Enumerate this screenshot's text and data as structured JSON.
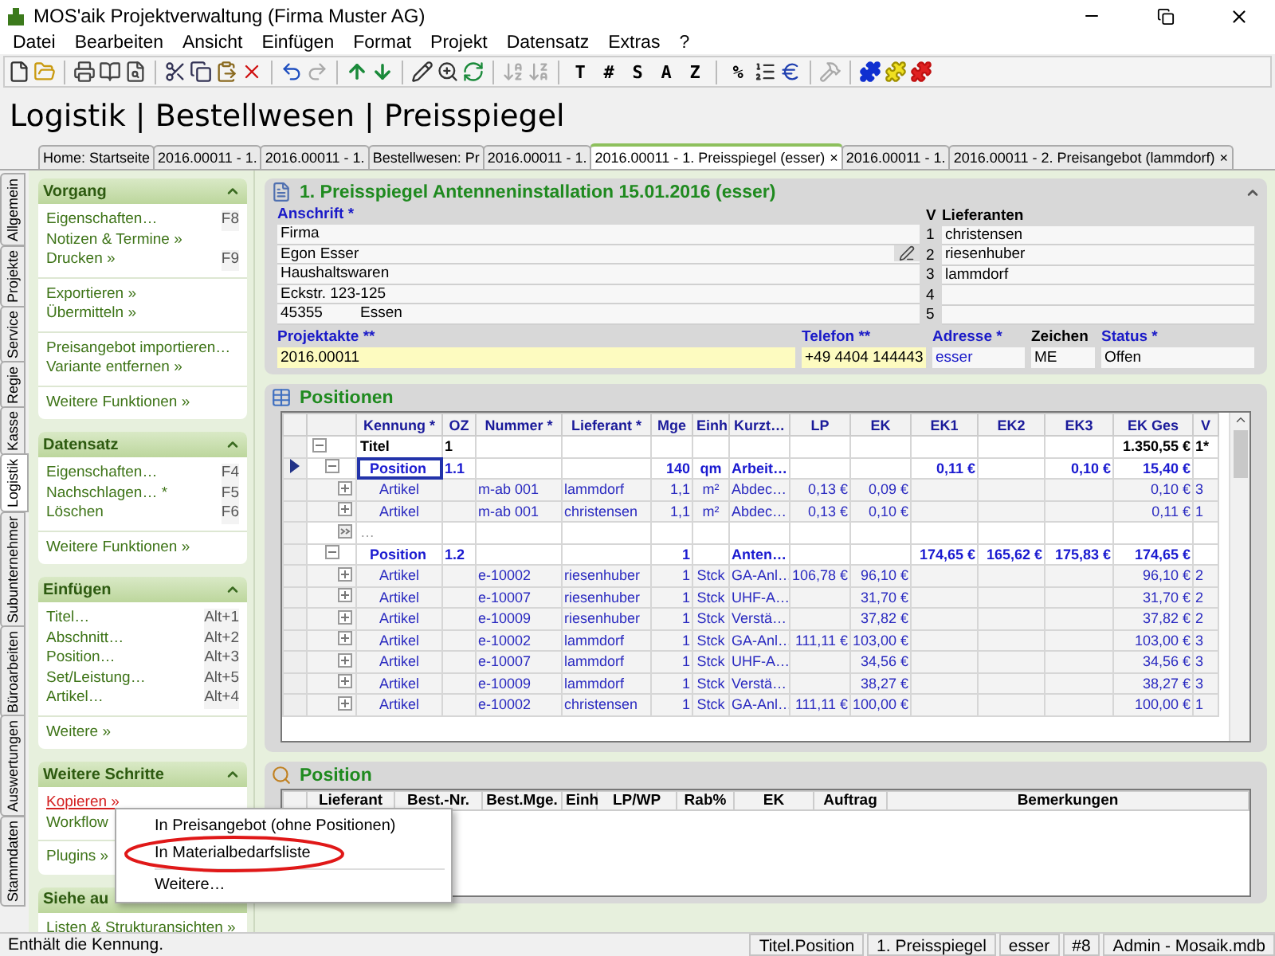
{
  "window": {
    "title": "MOS'aik Projektverwaltung (Firma Muster AG)"
  },
  "menu": [
    "Datei",
    "Bearbeiten",
    "Ansicht",
    "Einfügen",
    "Format",
    "Projekt",
    "Datensatz",
    "Extras",
    "?"
  ],
  "toolbar": {
    "text_buttons": [
      [
        "T",
        "#",
        "S",
        "A",
        "Z"
      ],
      [
        "%"
      ]
    ]
  },
  "heading": "Logistik | Bestellwesen | Preisspiegel",
  "doc_tabs": [
    {
      "label": "Home: Startseite",
      "selected": false
    },
    {
      "label": "2016.00011 - 1.",
      "selected": false
    },
    {
      "label": "2016.00011 - 1.",
      "selected": false
    },
    {
      "label": "Bestellwesen: Pr",
      "selected": false
    },
    {
      "label": "2016.00011 - 1.",
      "selected": false
    },
    {
      "label": "2016.00011 - 1. Preisspiegel (esser)",
      "close": "×",
      "selected": true
    },
    {
      "label": "2016.00011 - 1.",
      "selected": false
    },
    {
      "label": "2016.00011 - 2. Preisangebot (lammdorf)",
      "close": "×",
      "selected": false
    }
  ],
  "side_tabs": [
    {
      "label": "Allgemein",
      "selected": false
    },
    {
      "label": "Projekte",
      "selected": false
    },
    {
      "label": "Service",
      "selected": false
    },
    {
      "label": "Regie",
      "selected": false
    },
    {
      "label": "Kasse",
      "selected": false
    },
    {
      "label": "Logistik",
      "selected": true
    },
    {
      "label": "Subunternehmer",
      "selected": false
    },
    {
      "label": "Büroarbeiten",
      "selected": false
    },
    {
      "label": "Auswertungen",
      "selected": false
    },
    {
      "label": "Stammdaten",
      "selected": false
    }
  ],
  "sidebar": [
    {
      "title": "Vorgang",
      "expanded": true,
      "groups": [
        [
          {
            "label": "Eigenschaften…",
            "shortcut": "F8",
            "hovered": false
          },
          {
            "label": "Notizen & Termine »",
            "hovered": false
          },
          {
            "label": "Drucken »",
            "shortcut": "F9",
            "hovered": false
          }
        ],
        [
          {
            "label": "Exportieren »",
            "hovered": false
          },
          {
            "label": "Übermitteln »",
            "hovered": false
          }
        ],
        [
          {
            "label": "Preisangebot importieren…",
            "hovered": false
          },
          {
            "label": "Variante entfernen »",
            "hovered": false
          }
        ],
        [
          {
            "label": "Weitere Funktionen »",
            "hovered": false
          }
        ]
      ]
    },
    {
      "title": "Datensatz",
      "expanded": true,
      "groups": [
        [
          {
            "label": "Eigenschaften…",
            "shortcut": "F4",
            "hovered": false
          },
          {
            "label": "Nachschlagen… *",
            "shortcut": "F5",
            "hovered": false
          },
          {
            "label": "Löschen",
            "shortcut": "F6",
            "hovered": false
          }
        ],
        [
          {
            "label": "Weitere Funktionen »",
            "hovered": false
          }
        ]
      ]
    },
    {
      "title": "Einfügen",
      "expanded": true,
      "groups": [
        [
          {
            "label": "Titel…",
            "shortcut": "Alt+1",
            "hovered": false
          },
          {
            "label": "Abschnitt…",
            "shortcut": "Alt+2",
            "hovered": false
          },
          {
            "label": "Position…",
            "shortcut": "Alt+3",
            "hovered": false
          },
          {
            "label": "Set/Leistung…",
            "shortcut": "Alt+5",
            "hovered": false
          },
          {
            "label": "Artikel…",
            "shortcut": "Alt+4",
            "hovered": false
          }
        ],
        [
          {
            "label": "Weitere »",
            "hovered": false
          }
        ]
      ]
    },
    {
      "title": "Weitere Schritte",
      "expanded": true,
      "groups": [
        [
          {
            "label": "Kopieren »",
            "hovered": true
          },
          {
            "label": "Workflow",
            "hovered": false
          }
        ],
        [
          {
            "label": "Plugins »",
            "hovered": false
          }
        ]
      ]
    },
    {
      "title": "Siehe au",
      "groups": [
        [
          {
            "label": "Listen & Strukturansichten »",
            "hovered": false
          }
        ]
      ]
    }
  ],
  "popup": {
    "items": [
      {
        "label": "In Preisangebot (ohne Positionen)",
        "highlighted": false,
        "separator_before": false
      },
      {
        "label": "In Materialbedarfsliste",
        "highlighted": true,
        "separator_before": false
      },
      {
        "label": "Weitere…",
        "highlighted": false,
        "separator_before": true
      }
    ]
  },
  "document": {
    "title": "1. Preisspiegel Antenneninstallation 15.01.2016 (esser)",
    "address": {
      "label": "Anschrift *",
      "lines": [
        {
          "text": "Firma",
          "has_button": false
        },
        {
          "text": "Egon Esser",
          "has_button": true
        },
        {
          "text": "Haushaltswaren",
          "has_button": false
        },
        {
          "text": "Eckstr. 123-125",
          "has_button": false
        }
      ],
      "zip": "45355",
      "city": "Essen"
    },
    "suppliers": {
      "headers": [
        "V",
        "Lieferanten"
      ],
      "rows": [
        {
          "no": "1",
          "name": "christensen"
        },
        {
          "no": "2",
          "name": "riesenhuber"
        },
        {
          "no": "3",
          "name": "lammdorf"
        },
        {
          "no": "4"
        },
        {
          "no": "5"
        }
      ]
    },
    "fields": [
      {
        "label": "Projektakte **",
        "value": "2016.00011",
        "required": true,
        "highlight": true,
        "link": false
      },
      {
        "label": "Telefon **",
        "value": "+49 4404 144443",
        "required": true,
        "highlight": true,
        "link": false
      },
      {
        "label": "Adresse *",
        "value": "esser",
        "required": true,
        "highlight": false,
        "link": true
      },
      {
        "label": "Zeichen",
        "value": "ME",
        "required": false,
        "highlight": false,
        "link": false
      },
      {
        "label": "Status *",
        "value": "Offen",
        "required": true,
        "highlight": false,
        "link": false
      }
    ]
  },
  "grid": {
    "title": "Positionen",
    "columns": [
      "Kennung *",
      "OZ",
      "Nummer *",
      "Lieferant *",
      "Mge",
      "Einh",
      "Kurzt…",
      "LP",
      "EK",
      "EK1",
      "EK2",
      "EK3",
      "EK Ges",
      "V"
    ],
    "rows": [
      {
        "kind": "titel",
        "expanded": true,
        "selected": false,
        "cells": [
          "Titel",
          "1",
          "",
          "",
          "",
          "",
          "",
          "",
          "",
          "",
          "",
          "",
          "1.350,55 €",
          "1*"
        ],
        "children": [
          {
            "kind": "position",
            "expanded": true,
            "selected": true,
            "cells": [
              "Position",
              "1.1",
              "",
              "",
              "140",
              "qm",
              "Arbeit…",
              "",
              "",
              "0,11 €",
              "",
              "0,10 €",
              "15,40 €",
              ""
            ],
            "children": [
              {
                "kind": "artikel",
                "expanded": false,
                "selected": false,
                "cells": [
                  "Artikel",
                  "",
                  "m-ab 001",
                  "lammdorf",
                  "1,1",
                  "m²",
                  "Abdec…",
                  "0,13 €",
                  "0,09 €",
                  "",
                  "",
                  "",
                  "0,10 €",
                  "3"
                ]
              },
              {
                "kind": "artikel",
                "expanded": false,
                "selected": false,
                "cells": [
                  "Artikel",
                  "",
                  "m-ab 001",
                  "christensen",
                  "1,1",
                  "m²",
                  "Abdec…",
                  "0,13 €",
                  "0,10 €",
                  "",
                  "",
                  "",
                  "0,11 €",
                  "1"
                ]
              },
              {
                "kind": "more",
                "selected": false,
                "cells": [
                  "…",
                  "",
                  "",
                  "",
                  "",
                  "",
                  "",
                  "",
                  "",
                  "",
                  "",
                  "",
                  "",
                  ""
                ]
              }
            ]
          },
          {
            "kind": "position",
            "expanded": true,
            "selected": false,
            "cells": [
              "Position",
              "1.2",
              "",
              "",
              "1",
              "",
              "Anten…",
              "",
              "",
              "174,65 €",
              "165,62 €",
              "175,83 €",
              "174,65 €",
              ""
            ],
            "children": [
              {
                "kind": "artikel",
                "expanded": false,
                "selected": false,
                "cells": [
                  "Artikel",
                  "",
                  "e-10002",
                  "riesenhuber",
                  "1",
                  "Stck",
                  "GA-Anl…",
                  "106,78 €",
                  "96,10 €",
                  "",
                  "",
                  "",
                  "96,10 €",
                  "2"
                ]
              },
              {
                "kind": "artikel",
                "expanded": false,
                "selected": false,
                "cells": [
                  "Artikel",
                  "",
                  "e-10007",
                  "riesenhuber",
                  "1",
                  "Stck",
                  "UHF-A…",
                  "",
                  "31,70 €",
                  "",
                  "",
                  "",
                  "31,70 €",
                  "2"
                ]
              },
              {
                "kind": "artikel",
                "expanded": false,
                "selected": false,
                "cells": [
                  "Artikel",
                  "",
                  "e-10009",
                  "riesenhuber",
                  "1",
                  "Stck",
                  "Verstä…",
                  "",
                  "37,82 €",
                  "",
                  "",
                  "",
                  "37,82 €",
                  "2"
                ]
              },
              {
                "kind": "artikel",
                "expanded": false,
                "selected": false,
                "cells": [
                  "Artikel",
                  "",
                  "e-10002",
                  "lammdorf",
                  "1",
                  "Stck",
                  "GA-Anl…",
                  "111,11 €",
                  "103,00 €",
                  "",
                  "",
                  "",
                  "103,00 €",
                  "3"
                ]
              },
              {
                "kind": "artikel",
                "expanded": false,
                "selected": false,
                "cells": [
                  "Artikel",
                  "",
                  "e-10007",
                  "lammdorf",
                  "1",
                  "Stck",
                  "UHF-A…",
                  "",
                  "34,56 €",
                  "",
                  "",
                  "",
                  "34,56 €",
                  "3"
                ]
              },
              {
                "kind": "artikel",
                "expanded": false,
                "selected": false,
                "cells": [
                  "Artikel",
                  "",
                  "e-10009",
                  "lammdorf",
                  "1",
                  "Stck",
                  "Verstä…",
                  "",
                  "38,27 €",
                  "",
                  "",
                  "",
                  "38,27 €",
                  "3"
                ]
              },
              {
                "kind": "artikel",
                "expanded": false,
                "selected": false,
                "cells": [
                  "Artikel",
                  "",
                  "e-10002",
                  "christensen",
                  "1",
                  "Stck",
                  "GA-Anl…",
                  "111,11 €",
                  "100,00 €",
                  "",
                  "",
                  "",
                  "100,00 €",
                  "1"
                ]
              }
            ]
          }
        ]
      }
    ]
  },
  "position_panel": {
    "title": "Position",
    "columns": [
      "Lieferant",
      "Best.-Nr.",
      "Best.Mge.",
      "Einh",
      "LP/WP",
      "Rab%",
      "EK",
      "Auftrag",
      "Bemerkungen"
    ]
  },
  "status_bar": [
    "Enthält die Kennung.",
    "Titel.Position",
    "1. Preisspiegel",
    "esser",
    "#8",
    "Admin - Mosaik.mdb"
  ]
}
